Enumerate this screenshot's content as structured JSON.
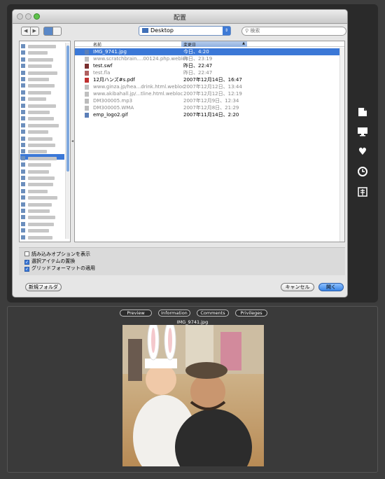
{
  "dialog": {
    "title": "配置",
    "location": "Desktop",
    "search_placeholder": "検索",
    "nav_back": "◀",
    "nav_forward": "▶"
  },
  "filelist": {
    "col_name": "名前",
    "col_date": "変更日",
    "files": [
      {
        "name": "IMG_9741.jpg",
        "date": "今日、4:20",
        "selected": true,
        "dim": false,
        "icon": "image-file-icon"
      },
      {
        "name": "www.scratchbrain....00124.php.webloc",
        "date": "昨日、23:19",
        "selected": false,
        "dim": true,
        "icon": "webloc-file-icon"
      },
      {
        "name": "test.swf",
        "date": "昨日、22:47",
        "selected": false,
        "dim": false,
        "icon": "swf-file-icon"
      },
      {
        "name": "test.fla",
        "date": "昨日、22:47",
        "selected": false,
        "dim": true,
        "icon": "fla-file-icon"
      },
      {
        "name": "12月ハンズ#s.pdf",
        "date": "2007年12月14日、16:47",
        "selected": false,
        "dim": false,
        "icon": "pdf-file-icon"
      },
      {
        "name": "www.ginza.jp/hea...drink.html.webloc",
        "date": "2007年12月12日、13:44",
        "selected": false,
        "dim": true,
        "icon": "webloc-file-icon"
      },
      {
        "name": "www.akibahall.jp/...tline.html.webloc",
        "date": "2007年12月12日、12:19",
        "selected": false,
        "dim": true,
        "icon": "webloc-file-icon"
      },
      {
        "name": "DM300005.mp3",
        "date": "2007年12月9日、12:34",
        "selected": false,
        "dim": true,
        "icon": "audio-file-icon"
      },
      {
        "name": "DM300005.WMA",
        "date": "2007年12月8日、21:29",
        "selected": false,
        "dim": true,
        "icon": "audio-file-icon"
      },
      {
        "name": "emp_logo2.gif",
        "date": "2007年11月14日、2:20",
        "selected": false,
        "dim": false,
        "icon": "image-file-icon"
      }
    ]
  },
  "options": {
    "show_import_options": "読み込みオプションを表示",
    "replace_selected": "選択アイテムの置換",
    "apply_grid_format": "グリッドフォーマットの適用"
  },
  "buttons": {
    "new_folder": "新規フォルダ",
    "cancel": "キャンセル",
    "open": "開く"
  },
  "bottom": {
    "tabs": [
      "Preview",
      "Information",
      "Comments",
      "Privileges"
    ],
    "preview_filename": "IMG_9741.jpg"
  },
  "colors": {
    "selection": "#3b78d7",
    "window_bg": "#e6e6e6",
    "outer_bg": "#3d3d3d"
  }
}
